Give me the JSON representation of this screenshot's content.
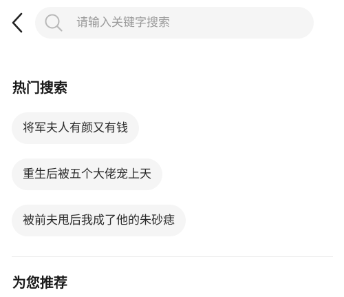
{
  "search": {
    "placeholder": "请输入关键字搜索",
    "value": ""
  },
  "hot_search": {
    "title": "热门搜索",
    "items": [
      {
        "label": "将军夫人有颜又有钱"
      },
      {
        "label": "重生后被五个大佬宠上天"
      },
      {
        "label": "被前夫甩后我成了他的朱砂痣"
      }
    ]
  },
  "recommend": {
    "title": "为您推荐"
  },
  "icons": {
    "back": "chevron-left-icon",
    "search": "search-icon"
  },
  "colors": {
    "background": "#ffffff",
    "chip_background": "#f5f5f5",
    "search_background": "#f5f5f5",
    "placeholder": "#9a9a9a",
    "title_text": "#1a1a1a",
    "chip_text": "#2a2a2a",
    "divider": "#ececec"
  }
}
